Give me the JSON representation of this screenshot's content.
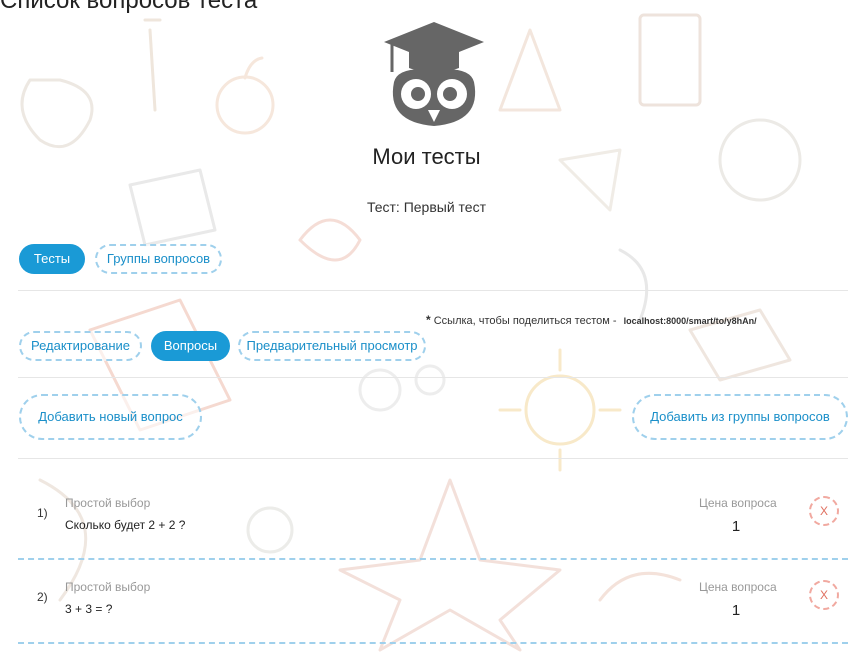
{
  "page": {
    "heading": "Список вопросов теста"
  },
  "header": {
    "logo_icon": "owl-graduate-icon",
    "title": "Мои тесты",
    "test_name": "Тест: Первый тест"
  },
  "main_tabs": [
    {
      "label": "Тесты",
      "active": true
    },
    {
      "label": "Группы вопросов",
      "active": false
    }
  ],
  "share": {
    "star": "*",
    "text": "Ссылка, чтобы поделиться тестом -",
    "link": "localhost:8000/smart/to/y8hAn/"
  },
  "sub_tabs": [
    {
      "label": "Редактирование",
      "active": false
    },
    {
      "label": "Вопросы",
      "active": true
    },
    {
      "label": "Предварительный просмотр",
      "active": false
    }
  ],
  "actions": {
    "add_new": "Добавить новый вопрос",
    "add_from_group": "Добавить из группы вопросов"
  },
  "questions": [
    {
      "num": "1)",
      "type": "Простой выбор",
      "text": "Сколько будет 2 + 2 ?",
      "price_label": "Цена вопроса",
      "price": "1",
      "delete_label": "X"
    },
    {
      "num": "2)",
      "type": "Простой выбор",
      "text": "3 + 3 = ?",
      "price_label": "Цена вопроса",
      "price": "1",
      "delete_label": "X"
    }
  ],
  "colors": {
    "accent": "#1a9ad6",
    "dashed_border": "#9fd0ec",
    "delete": "#e07060"
  }
}
